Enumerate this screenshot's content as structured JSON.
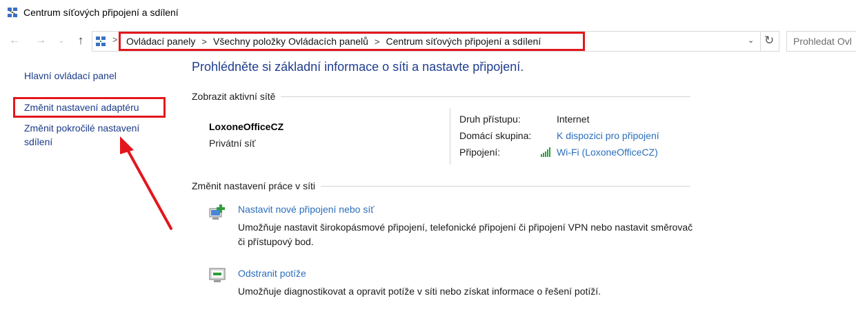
{
  "window": {
    "title": "Centrum síťových připojení a sdílení",
    "icon": "network-sharing-center-icon"
  },
  "nav": {
    "back_icon": "←",
    "forward_icon": "→",
    "recent_icon": "⌄",
    "up_icon": "↑",
    "refresh_icon": "↻",
    "dropdown_icon": "⌄",
    "crumb_sep": ">"
  },
  "address": {
    "crumbs": [
      "Ovládací panely",
      "Všechny položky Ovládacích panelů",
      "Centrum síťových připojení a sdílení"
    ]
  },
  "search": {
    "placeholder": "Prohledat Ovl"
  },
  "sidebar": {
    "items": [
      "Hlavní ovládací panel",
      "Změnit nastavení adaptéru",
      "Změnit pokročilé nastavení sdílení"
    ]
  },
  "main": {
    "title": "Prohlédněte si základní informace o síti a nastavte připojení.",
    "active_networks_heading": "Zobrazit aktivní sítě",
    "network": {
      "name": "LoxoneOfficeCZ",
      "type": "Privátní síť",
      "access_type_label": "Druh přístupu:",
      "access_type_value": "Internet",
      "homegroup_label": "Domácí skupina:",
      "homegroup_value": "K dispozici pro připojení",
      "connections_label": "Připojení:",
      "connections_value": "Wi-Fi (LoxoneOfficeCZ)"
    },
    "change_settings_heading": "Změnit nastavení práce v síti",
    "tasks": [
      {
        "link": "Nastavit nové připojení nebo síť",
        "description": "Umožňuje nastavit širokopásmové připojení, telefonické připojení či připojení VPN nebo nastavit směrovač či přístupový bod."
      },
      {
        "link": "Odstranit potíže",
        "description": "Umožňuje diagnostikovat a opravit potíže v síti nebo získat informace o řešení potíží."
      }
    ]
  },
  "colors": {
    "highlight": "#e3161c",
    "link": "#2a6ebb",
    "title": "#1e3d8f",
    "wifi": "#2e9e3a"
  }
}
